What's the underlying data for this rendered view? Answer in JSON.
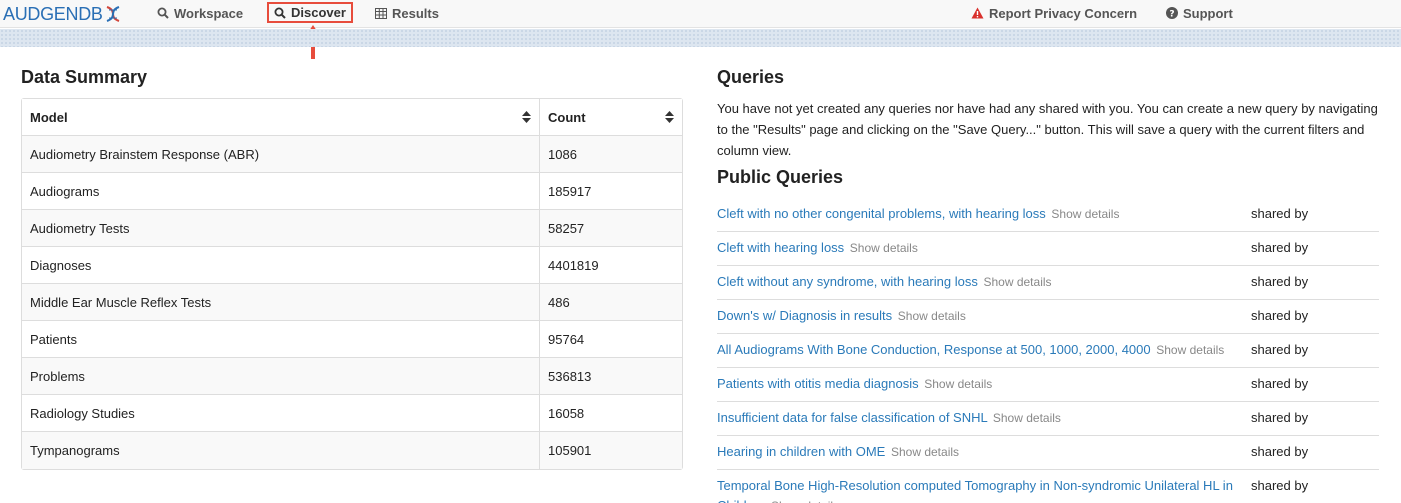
{
  "nav": {
    "brand": "AUDGENDB",
    "items": [
      {
        "label": "Workspace",
        "icon": "search-icon"
      },
      {
        "label": "Discover",
        "icon": "search-icon"
      },
      {
        "label": "Results",
        "icon": "table-icon"
      }
    ],
    "right": [
      {
        "label": "Report Privacy Concern",
        "icon": "warning-icon"
      },
      {
        "label": "Support",
        "icon": "question-icon"
      }
    ]
  },
  "summary": {
    "title": "Data Summary",
    "columns": [
      "Model",
      "Count"
    ],
    "rows": [
      {
        "model": "Audiometry Brainstem Response (ABR)",
        "count": "1086"
      },
      {
        "model": "Audiograms",
        "count": "185917"
      },
      {
        "model": "Audiometry Tests",
        "count": "58257"
      },
      {
        "model": "Diagnoses",
        "count": "4401819"
      },
      {
        "model": "Middle Ear Muscle Reflex Tests",
        "count": "486"
      },
      {
        "model": "Patients",
        "count": "95764"
      },
      {
        "model": "Problems",
        "count": "536813"
      },
      {
        "model": "Radiology Studies",
        "count": "16058"
      },
      {
        "model": "Tympanograms",
        "count": "105901"
      }
    ]
  },
  "queries": {
    "title": "Queries",
    "text": "You have not yet created any queries nor have had any shared with you. You can create a new query by navigating to the \"Results\" page and clicking on the \"Save Query...\" button. This will save a query with the current filters and column view."
  },
  "public_queries": {
    "title": "Public Queries",
    "details_label": "Show details",
    "shared_label": "shared by",
    "items": [
      "Cleft with no other congenital problems, with hearing loss",
      "Cleft with hearing loss",
      "Cleft without any syndrome, with hearing loss",
      "Down's w/ Diagnosis in results",
      "All Audiograms With Bone Conduction, Response at 500, 1000, 2000, 4000",
      "Patients with otitis media diagnosis",
      "Insufficient data for false classification of SNHL",
      "Hearing in children with OME",
      "Temporal Bone High-Resolution computed Tomography in Non-syndromic Unilateral HL in Children"
    ]
  },
  "colors": {
    "brand": "#2a6fb5",
    "link": "#2a7ab9",
    "highlight": "#e74c3c",
    "warning": "#d9302c"
  }
}
